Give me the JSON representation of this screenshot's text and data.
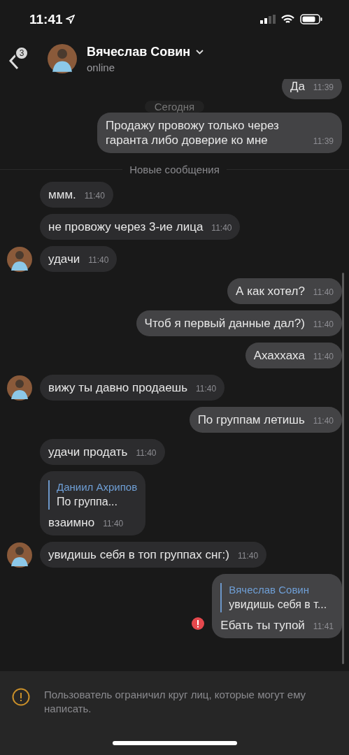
{
  "status_bar": {
    "time": "11:41"
  },
  "header": {
    "back_badge": "3",
    "name": "Вячеслав Совин",
    "status": "online"
  },
  "messages": [
    {
      "kind": "message",
      "outgoing": true,
      "text": "Да",
      "time": "11:39",
      "failed": false
    },
    {
      "kind": "date",
      "text": "Сегодня"
    },
    {
      "kind": "message",
      "outgoing": true,
      "text": "Продажу провожу только через гаранта либо доверие ко мне",
      "time": "11:39",
      "failed": false
    },
    {
      "kind": "divider",
      "text": "Новые сообщения"
    },
    {
      "kind": "message",
      "outgoing": false,
      "text": "ммм.",
      "time": "11:40",
      "avatar": false
    },
    {
      "kind": "message",
      "outgoing": false,
      "text": "не провожу через 3-ие лица",
      "time": "11:40",
      "avatar": false
    },
    {
      "kind": "message",
      "outgoing": false,
      "text": "удачи",
      "time": "11:40",
      "avatar": true
    },
    {
      "kind": "message",
      "outgoing": true,
      "text": "А как хотел?",
      "time": "11:40",
      "failed": false
    },
    {
      "kind": "message",
      "outgoing": true,
      "text": "Чтоб я первый данные дал?)",
      "time": "11:40",
      "failed": false
    },
    {
      "kind": "message",
      "outgoing": true,
      "text": "Ахаххаха",
      "time": "11:40",
      "failed": false
    },
    {
      "kind": "message",
      "outgoing": false,
      "text": "вижу ты давно продаешь",
      "time": "11:40",
      "avatar": true
    },
    {
      "kind": "message",
      "outgoing": true,
      "text": "По группам летишь",
      "time": "11:40",
      "failed": false
    },
    {
      "kind": "message",
      "outgoing": false,
      "text": "удачи продать",
      "time": "11:40",
      "avatar": false
    },
    {
      "kind": "message",
      "outgoing": false,
      "text": "взаимно",
      "time": "11:40",
      "avatar": false,
      "reply": {
        "author": "Даниил Ахрипов",
        "text": "По группа..."
      }
    },
    {
      "kind": "message",
      "outgoing": false,
      "text": "увидишь себя в топ группах снг:)",
      "time": "11:40",
      "avatar": true
    },
    {
      "kind": "message",
      "outgoing": true,
      "text": "Ебать ты тупой",
      "time": "11:41",
      "failed": true,
      "reply": {
        "author": "Вячеслав Совин",
        "text": "увидишь себя в т..."
      }
    }
  ],
  "notice": {
    "text": "Пользователь ограничил круг лиц, которые могут ему написать."
  }
}
